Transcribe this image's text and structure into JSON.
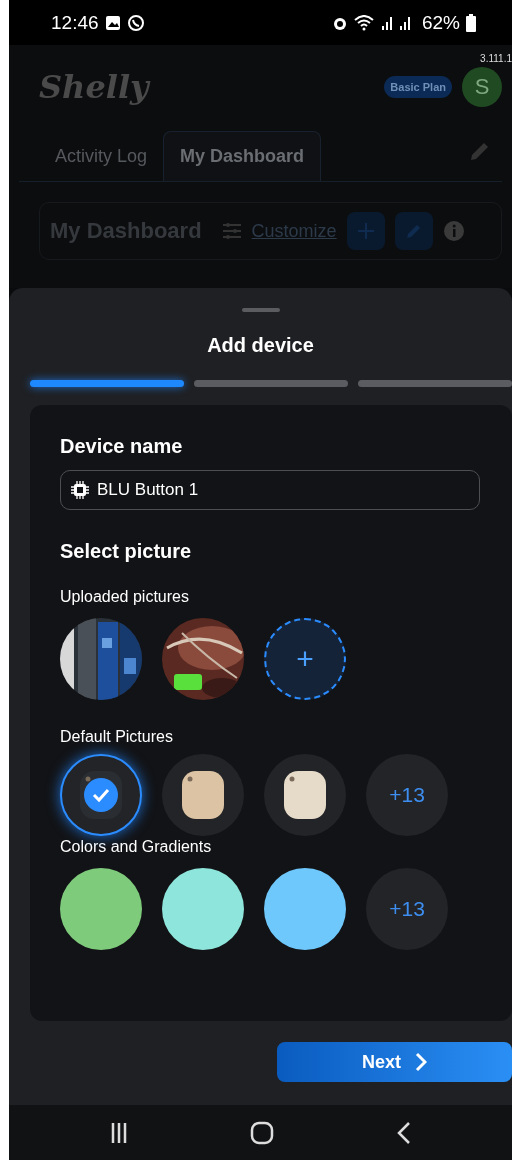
{
  "status_bar": {
    "time": "12:46",
    "battery": "62%"
  },
  "app": {
    "logo": "Shelly",
    "version": "3.111.1",
    "plan_badge": "Basic Plan",
    "avatar": "S",
    "tabs": [
      {
        "label": "Activity Log",
        "selected": false
      },
      {
        "label": "My Dashboard",
        "selected": true
      }
    ],
    "dashboard_title": "My Dashboard",
    "customize": "Customize"
  },
  "sheet": {
    "title": "Add device",
    "steps": [
      {
        "active": true
      },
      {
        "active": false
      },
      {
        "active": false
      }
    ],
    "device_name_label": "Device name",
    "device_name_value": "BLU Button 1",
    "select_picture_label": "Select picture",
    "uploaded_label": "Uploaded pictures",
    "uploaded": [
      {
        "kind": "picture"
      },
      {
        "kind": "picture"
      },
      {
        "kind": "add",
        "label": "+"
      }
    ],
    "default_label": "Default Pictures",
    "defaults": [
      {
        "kind": "device",
        "color": "#2a2d31",
        "selected": true
      },
      {
        "kind": "device",
        "color": "#dcc3a4",
        "selected": false
      },
      {
        "kind": "device",
        "color": "#e6dbc8",
        "selected": false
      },
      {
        "kind": "more",
        "label": "+13"
      }
    ],
    "colors_label": "Colors and Gradients",
    "colors": [
      {
        "kind": "swatch",
        "color": "#7fcb7c"
      },
      {
        "kind": "swatch",
        "color": "#8ee5db"
      },
      {
        "kind": "swatch",
        "color": "#6ec8fc"
      },
      {
        "kind": "more",
        "label": "+13"
      }
    ],
    "next_button": "Next"
  }
}
